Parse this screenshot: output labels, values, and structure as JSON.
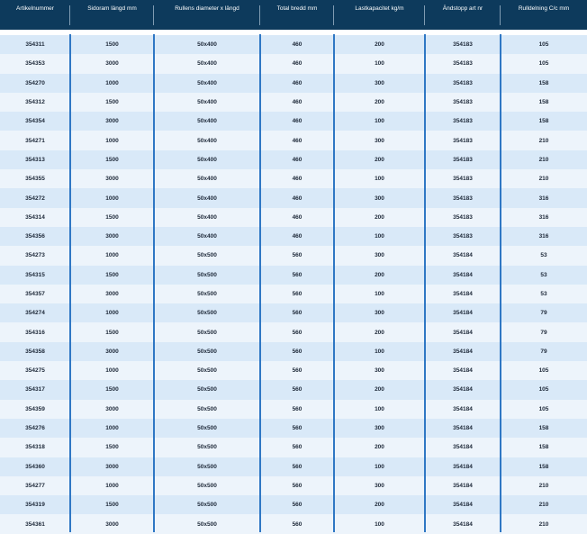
{
  "table": {
    "headers": [
      "Artikelnummer",
      "Sidoram längd mm",
      "Rullens diameter x längd",
      "Total bredd mm",
      "Lastkapacitet kg/m",
      "Ändstopp art nr",
      "Rulldelning C/c mm"
    ],
    "rows": [
      [
        "354311",
        "1500",
        "50x400",
        "460",
        "200",
        "354183",
        "105"
      ],
      [
        "354353",
        "3000",
        "50x400",
        "460",
        "100",
        "354183",
        "105"
      ],
      [
        "354270",
        "1000",
        "50x400",
        "460",
        "300",
        "354183",
        "158"
      ],
      [
        "354312",
        "1500",
        "50x400",
        "460",
        "200",
        "354183",
        "158"
      ],
      [
        "354354",
        "3000",
        "50x400",
        "460",
        "100",
        "354183",
        "158"
      ],
      [
        "354271",
        "1000",
        "50x400",
        "460",
        "300",
        "354183",
        "210"
      ],
      [
        "354313",
        "1500",
        "50x400",
        "460",
        "200",
        "354183",
        "210"
      ],
      [
        "354355",
        "3000",
        "50x400",
        "460",
        "100",
        "354183",
        "210"
      ],
      [
        "354272",
        "1000",
        "50x400",
        "460",
        "300",
        "354183",
        "316"
      ],
      [
        "354314",
        "1500",
        "50x400",
        "460",
        "200",
        "354183",
        "316"
      ],
      [
        "354356",
        "3000",
        "50x400",
        "460",
        "100",
        "354183",
        "316"
      ],
      [
        "354273",
        "1000",
        "50x500",
        "560",
        "300",
        "354184",
        "53"
      ],
      [
        "354315",
        "1500",
        "50x500",
        "560",
        "200",
        "354184",
        "53"
      ],
      [
        "354357",
        "3000",
        "50x500",
        "560",
        "100",
        "354184",
        "53"
      ],
      [
        "354274",
        "1000",
        "50x500",
        "560",
        "300",
        "354184",
        "79"
      ],
      [
        "354316",
        "1500",
        "50x500",
        "560",
        "200",
        "354184",
        "79"
      ],
      [
        "354358",
        "3000",
        "50x500",
        "560",
        "100",
        "354184",
        "79"
      ],
      [
        "354275",
        "1000",
        "50x500",
        "560",
        "300",
        "354184",
        "105"
      ],
      [
        "354317",
        "1500",
        "50x500",
        "560",
        "200",
        "354184",
        "105"
      ],
      [
        "354359",
        "3000",
        "50x500",
        "560",
        "100",
        "354184",
        "105"
      ],
      [
        "354276",
        "1000",
        "50x500",
        "560",
        "300",
        "354184",
        "158"
      ],
      [
        "354318",
        "1500",
        "50x500",
        "560",
        "200",
        "354184",
        "158"
      ],
      [
        "354360",
        "3000",
        "50x500",
        "560",
        "100",
        "354184",
        "158"
      ],
      [
        "354277",
        "1000",
        "50x500",
        "560",
        "300",
        "354184",
        "210"
      ],
      [
        "354319",
        "1500",
        "50x500",
        "560",
        "200",
        "354184",
        "210"
      ],
      [
        "354361",
        "3000",
        "50x500",
        "560",
        "100",
        "354184",
        "210"
      ]
    ]
  },
  "colors": {
    "header_bg": "#0d3a5c",
    "row_light": "#edf4fb",
    "row_dark": "#d9e9f8",
    "divider": "#2f77c4"
  }
}
